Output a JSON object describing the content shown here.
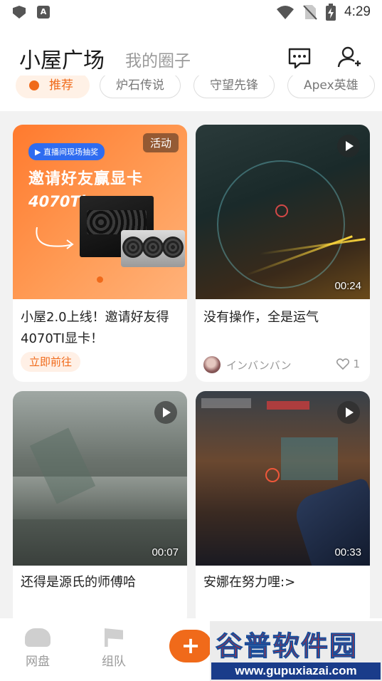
{
  "status_bar": {
    "time": "4:29",
    "icons": [
      "shield-icon",
      "a-icon",
      "wifi-icon",
      "no-sim-icon",
      "battery-charging-icon"
    ]
  },
  "header": {
    "title": "小屋广场",
    "subtitle": "我的圈子",
    "message_icon": "chat-bubble-icon",
    "profile_icon": "add-user-icon"
  },
  "tabs": [
    {
      "label": "推荐",
      "active": true
    },
    {
      "label": "炉石传说",
      "active": false
    },
    {
      "label": "守望先锋",
      "active": false
    },
    {
      "label": "Apex英雄",
      "active": false
    }
  ],
  "cards": [
    {
      "type": "promo",
      "tag": "活动",
      "banner_pill": "直播间现场抽奖",
      "banner_headline": "邀请好友赢显卡",
      "banner_product": "4070Ti",
      "title": "小屋2.0上线！邀请好友得4070TI显卡！",
      "action": "立即前往"
    },
    {
      "type": "video",
      "duration": "00:24",
      "title": "没有操作，全是运气",
      "author": "インバンバン",
      "likes": "1"
    },
    {
      "type": "video",
      "duration": "00:07",
      "title": "还得是源氏的师傅哈"
    },
    {
      "type": "video",
      "duration": "00:33",
      "title": "安娜在努力哩:>"
    }
  ],
  "bottom_nav": [
    {
      "label": "网盘",
      "icon": "cloud-icon"
    },
    {
      "label": "组队",
      "icon": "flag-icon"
    }
  ],
  "fab": {
    "label": "+"
  },
  "watermark": {
    "top": "谷普软件园",
    "url": "www.gupuxiazai.com"
  },
  "colors": {
    "accent": "#f06a1a",
    "promo_blue": "#2f6cf0",
    "watermark_red": "#e8231a",
    "watermark_blue": "#1a3c8a"
  }
}
